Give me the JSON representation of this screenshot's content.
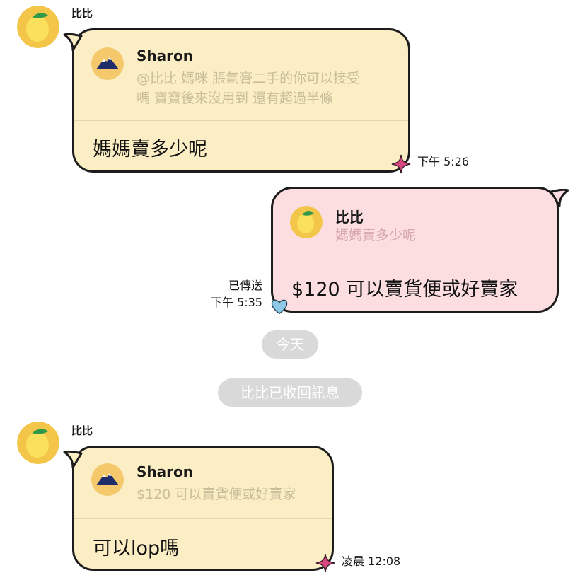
{
  "messages": [
    {
      "sender": "比比",
      "quote": {
        "name": "Sharon",
        "text_line1": "@比比 媽咪 脹氣膏二手的你可以接受",
        "text_line2": "嗎 寶寶後來沒用到 還有超過半條"
      },
      "text": "媽媽賣多少呢",
      "time": "下午 5:26"
    },
    {
      "sender": "self",
      "quote": {
        "name": "比比",
        "text_line1": "媽媽賣多少呢"
      },
      "text": "$120 可以賣貨便或好賣家",
      "status": "已傳送",
      "time": "下午 5:35"
    },
    {
      "sender": "比比",
      "quote": {
        "name": "Sharon",
        "text_line1": "$120 可以賣貨便或好賣家"
      },
      "text": "可以lop嗎",
      "time": "凌晨 12:08"
    }
  ],
  "system": {
    "date_divider": "今天",
    "recalled_notice": "比比已收回訊息"
  },
  "colors": {
    "bubble_received": "#fbeec4",
    "bubble_sent": "#fcdde0",
    "pill": "#d9d9d9",
    "sticker_star": "#d9477f",
    "sticker_heart": "#8ec9e8"
  },
  "icons": {
    "avatar_bibi": "lemon-avatar-icon",
    "avatar_sharon": "mountain-avatar-icon",
    "sticker_star": "star-sticker-icon",
    "sticker_heart": "heart-sticker-icon"
  }
}
